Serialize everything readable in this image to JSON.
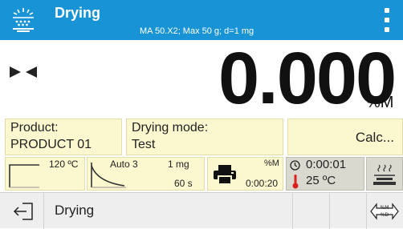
{
  "header": {
    "title": "Drying",
    "subtitle": "MA 50.X2; Max 50 g; d=1 mg",
    "icon": "drying-program-icon",
    "menu_icon": "more-vertical-icon",
    "color": "#1893d6"
  },
  "display": {
    "weight": "0.000",
    "unit": "%M",
    "stable_icon": "stability-marker-icon"
  },
  "info": {
    "product_label": "Product:",
    "product_value": "PRODUCT 01",
    "mode_label": "Drying mode:",
    "mode_value": "Test",
    "calc_label": "Calc..."
  },
  "params": {
    "temperature": "120 ºC",
    "finish_mode": "Auto 3",
    "finish_mass": "1 mg",
    "finish_time": "60 s",
    "print_unit": "%M",
    "print_interval": "0:00:20",
    "elapsed_time": "0:00:01",
    "chamber_temp": "25 ºC",
    "profile_icon": "heating-profile-icon",
    "finish_icon": "drying-curve-icon",
    "print_icon": "printer-icon",
    "clock_icon": "clock-icon",
    "thermometer_icon": "thermometer-icon",
    "scale_icon": "heating-scale-icon"
  },
  "bottom": {
    "label": "Drying",
    "exit_icon": "exit-icon",
    "unit_switch_icon": "unit-switch-icon"
  },
  "colors": {
    "accent": "#1893d6",
    "panel": "#fbf7cf",
    "status": "#d9d9d0",
    "thermometer": "#e02020"
  }
}
